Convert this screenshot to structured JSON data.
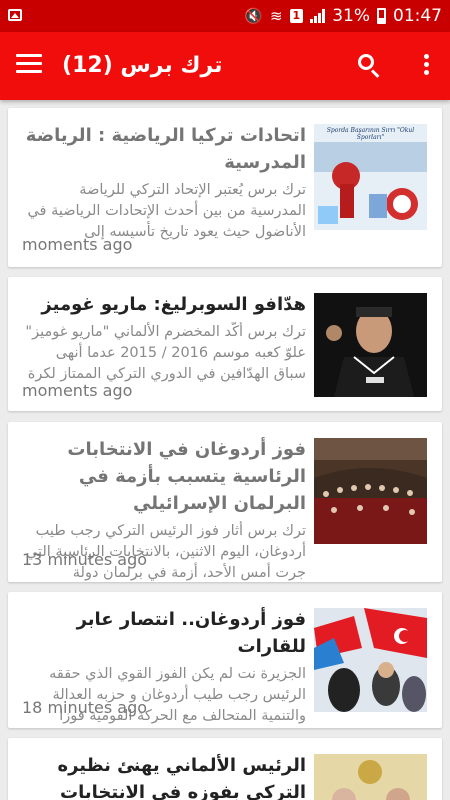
{
  "status_bar": {
    "battery": "31%",
    "time": "01:47",
    "sim_badge": "1"
  },
  "app_bar": {
    "title": "ترك برس (12)"
  },
  "articles": [
    {
      "title": "اتحادات تركيا الرياضية : الرياضة المدرسية",
      "excerpt": "ترك برس يُعتبر الإتحاد التركي للرياضة المدرسية من بين أحدث الإتحادات الرياضية في الأناضول حيث يعود تاريخ تأسيسه إلى",
      "time": "moments ago",
      "thumb_caption": "Sporda Başarının Sırrı \"Okul Sporları\""
    },
    {
      "title": "هدّافو السوبرليغ: ماريو غوميز",
      "excerpt": "ترك برس أكّد المخضرم الألماني \"ماريو غوميز\" علوّ كعبه موسم 2016 / 2015 عدما أنهى سباق الهدّافين في الدوري التركي الممتاز لكرة",
      "time": "moments ago",
      "thumb_caption": ""
    },
    {
      "title": "فوز أردوغان في الانتخابات الرئاسية يتسبب بأزمة في البرلمان الإسرائيلي",
      "excerpt": "ترك برس أثار فوز الرئيس التركي رجب طيب أردوغان، اليوم الاثنين، بالانتخابات الرئاسية التي جرت أمس الأحد، أزمة في برلمان دولة",
      "time": "13 minutes ago",
      "thumb_caption": ""
    },
    {
      "title": "فوز أردوغان.. انتصار عابر للقارات",
      "excerpt": "الجزيرة نت لم يكن الفوز القوي الذي حققه الرئيس رجب طيب أردوغان و حزبه العدالة والتنمية المتحالف مع الحركة القومية فوزا",
      "time": "18 minutes ago",
      "thumb_caption": ""
    },
    {
      "title": "الرئيس الألماني يهنئ نظيره التركي بفوزه في الانتخابات",
      "excerpt": "",
      "time": "",
      "thumb_caption": ""
    }
  ],
  "colors": {
    "status_bar": "#c90000",
    "app_bar": "#f20d0d",
    "background": "#ececec"
  }
}
